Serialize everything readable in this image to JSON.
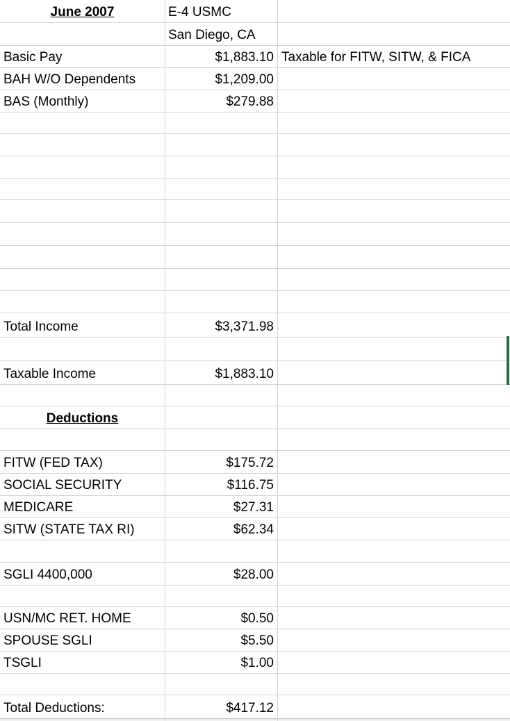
{
  "header": {
    "month": "June 2007",
    "rank_branch": "E-4 USMC",
    "location": "San Diego, CA"
  },
  "income": {
    "basic_pay_label": "Basic Pay",
    "basic_pay_value": "$1,883.10",
    "basic_pay_note": "Taxable for FITW, SITW, & FICA",
    "bah_label": "BAH W/O Dependents",
    "bah_value": "$1,209.00",
    "bas_label": "BAS (Monthly)",
    "bas_value": "$279.88"
  },
  "totals": {
    "total_income_label": "Total Income",
    "total_income_value": "$3,371.98",
    "taxable_income_label": "Taxable Income",
    "taxable_income_value": "$1,883.10"
  },
  "deductions": {
    "heading": "Deductions",
    "items": [
      {
        "label": "FITW (FED TAX)",
        "value": "$175.72"
      },
      {
        "label": "SOCIAL SECURITY",
        "value": "$116.75"
      },
      {
        "label": "MEDICARE",
        "value": "$27.31"
      },
      {
        "label": "SITW (STATE TAX RI)",
        "value": "$62.34"
      },
      {
        "label": "SGLI 4400,000",
        "value": "$28.00"
      },
      {
        "label": "USN/MC RET. HOME",
        "value": "$0.50"
      },
      {
        "label": "SPOUSE SGLI",
        "value": "$5.50"
      },
      {
        "label": "TSGLI",
        "value": "$1.00"
      }
    ],
    "total_label": "Total Deductions:",
    "total_value": "$417.12"
  },
  "colors": {
    "grid": "#d4d4d4",
    "selection": "#217346"
  }
}
